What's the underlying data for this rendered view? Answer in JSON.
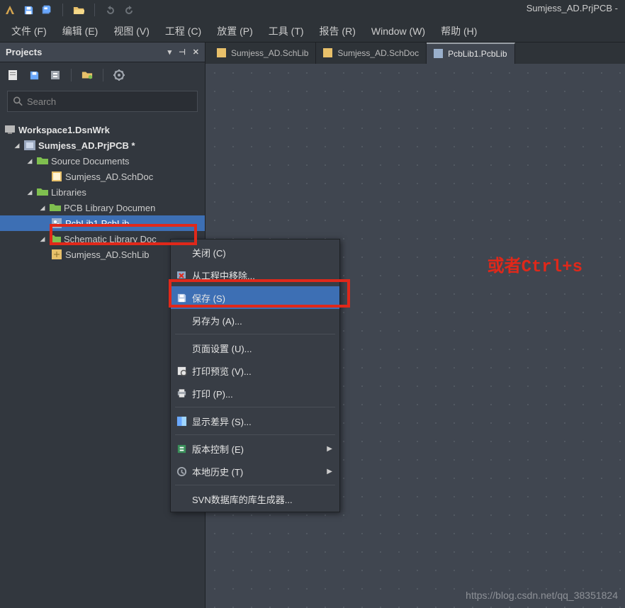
{
  "app": {
    "title": "Sumjess_AD.PrjPCB -"
  },
  "menu": {
    "file": "文件 (F)",
    "edit": "编辑 (E)",
    "view": "视图 (V)",
    "project": "工程 (C)",
    "place": "放置 (P)",
    "tools": "工具 (T)",
    "report": "报告 (R)",
    "window": "Window (W)",
    "help": "帮助 (H)"
  },
  "panel": {
    "title": "Projects",
    "search_placeholder": "Search"
  },
  "tree": {
    "workspace": "Workspace1.DsnWrk",
    "project": "Sumjess_AD.PrjPCB *",
    "srcdocs": "Source Documents",
    "schdoc": "Sumjess_AD.SchDoc",
    "libs": "Libraries",
    "pcblibdoc": "PCB Library Documen",
    "pcblib": "PcbLib1.PcbLib",
    "schlibdoc": "Schematic Library Doc",
    "schlib": "Sumjess_AD.SchLib"
  },
  "tabs": {
    "t1": "Sumjess_AD.SchLib",
    "t2": "Sumjess_AD.SchDoc",
    "t3": "PcbLib1.PcbLib"
  },
  "context_menu": {
    "close": "关闭 (C)",
    "remove": "从工程中移除...",
    "save": "保存 (S)",
    "saveas": "另存为 (A)...",
    "pagesetup": "页面设置 (U)...",
    "printpreview": "打印预览 (V)...",
    "print": "打印 (P)...",
    "showdiff": "显示差异 (S)...",
    "version": "版本控制 (E)",
    "history": "本地历史 (T)",
    "svn": "SVN数据库的库生成器..."
  },
  "annotation": "或者Ctrl+s",
  "watermark": "https://blog.csdn.net/qq_38351824"
}
